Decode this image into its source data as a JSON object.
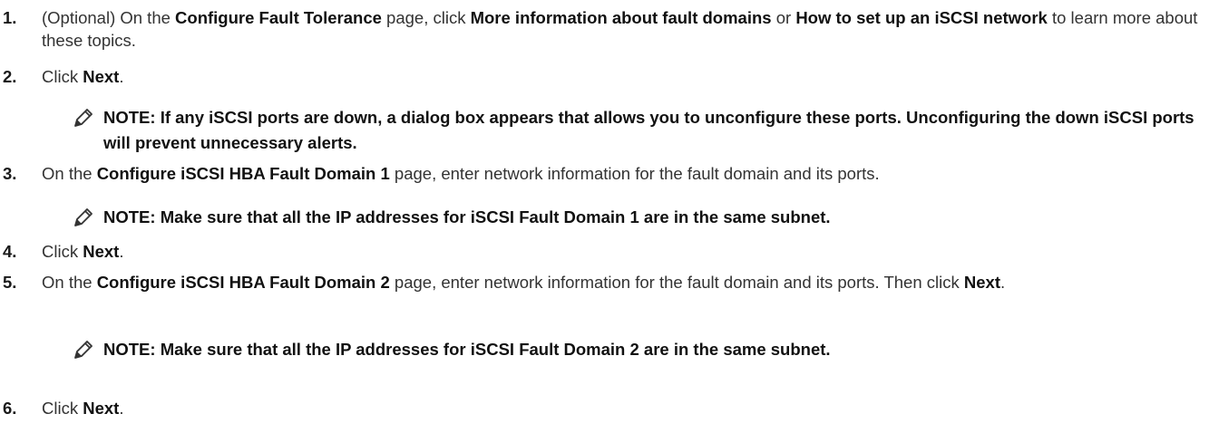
{
  "steps": [
    {
      "number": "1.",
      "segments": [
        {
          "text": "(Optional) On the ",
          "bold": false
        },
        {
          "text": "Configure Fault Tolerance",
          "bold": true
        },
        {
          "text": " page, click ",
          "bold": false
        },
        {
          "text": "More information about fault domains",
          "bold": true
        },
        {
          "text": " or ",
          "bold": false
        },
        {
          "text": "How to set up an iSCSI network",
          "bold": true
        },
        {
          "text": " to learn more about these topics.",
          "bold": false
        }
      ]
    },
    {
      "number": "2.",
      "segments": [
        {
          "text": "Click ",
          "bold": false
        },
        {
          "text": "Next",
          "bold": true
        },
        {
          "text": ".",
          "bold": false
        }
      ],
      "note": "NOTE: If any iSCSI ports are down, a dialog box appears that allows you to unconfigure these ports. Unconfiguring the down iSCSI ports will prevent unnecessary alerts."
    },
    {
      "number": "3.",
      "segments": [
        {
          "text": "On the ",
          "bold": false
        },
        {
          "text": "Configure iSCSI HBA Fault Domain 1",
          "bold": true
        },
        {
          "text": " page, enter network information for the fault domain and its ports.",
          "bold": false
        }
      ],
      "note": "NOTE: Make sure that all the IP addresses for iSCSI Fault Domain 1 are in the same subnet."
    },
    {
      "number": "4.",
      "segments": [
        {
          "text": "Click ",
          "bold": false
        },
        {
          "text": "Next",
          "bold": true
        },
        {
          "text": ".",
          "bold": false
        }
      ]
    },
    {
      "number": "5.",
      "segments": [
        {
          "text": "On the ",
          "bold": false
        },
        {
          "text": "Configure iSCSI HBA Fault Domain 2",
          "bold": true
        },
        {
          "text": " page, enter network information for the fault domain and its ports. Then click ",
          "bold": false
        },
        {
          "text": "Next",
          "bold": true
        },
        {
          "text": ".",
          "bold": false
        }
      ],
      "note": "NOTE: Make sure that all the IP addresses for iSCSI Fault Domain 2 are in the same subnet."
    },
    {
      "number": "6.",
      "segments": [
        {
          "text": "Click ",
          "bold": false
        },
        {
          "text": "Next",
          "bold": true
        },
        {
          "text": ".",
          "bold": false
        }
      ]
    }
  ],
  "icons": {
    "note": "pencil-note-icon"
  }
}
